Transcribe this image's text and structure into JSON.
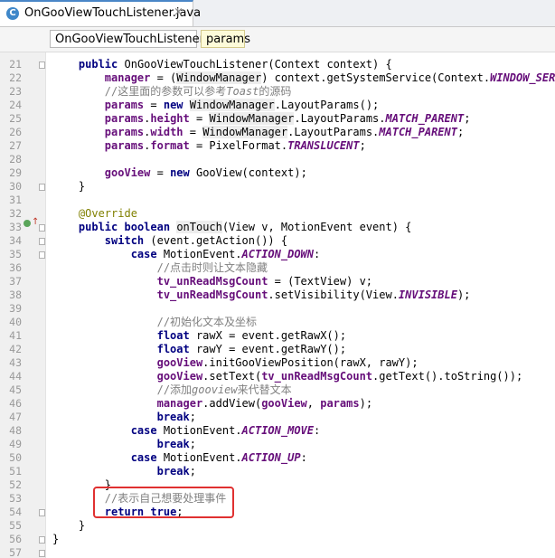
{
  "tab": {
    "icon": "class-c-icon",
    "title": "OnGooViewTouchListener.java",
    "close": "×"
  },
  "breadcrumbs": [
    "OnGooViewTouchListener",
    "params"
  ],
  "line_numbers": [
    "21",
    "22",
    "23",
    "24",
    "25",
    "26",
    "27",
    "28",
    "29",
    "30",
    "31",
    "32",
    "33",
    "34",
    "35",
    "36",
    "37",
    "38",
    "39",
    "40",
    "41",
    "42",
    "43",
    "44",
    "45",
    "46",
    "47",
    "48",
    "49",
    "50",
    "51",
    "52",
    "53",
    "54",
    "55",
    "56",
    "57"
  ],
  "code": {
    "l21": {
      "a": "public",
      "b": " OnGooViewTouchListener(Context context) {"
    },
    "l22": {
      "a": "manager",
      "b": " = (",
      "c": "WindowManager",
      "d": ") context.getSystemService(Context.",
      "e": "WINDOW_SERVIC"
    },
    "l23": {
      "a": "//这里面的参数可以参考",
      "b": "Toast",
      "c": "的源码"
    },
    "l24": {
      "a": "params",
      "b": " = ",
      "c": "new",
      "d": " ",
      "e": "WindowManager",
      "f": ".LayoutParams();"
    },
    "l25": {
      "a": "params",
      "b": ".",
      "c": "height",
      "d": " = ",
      "e": "WindowManager",
      "f": ".LayoutParams.",
      "g": "MATCH_PARENT",
      "h": ";"
    },
    "l26": {
      "a": "params",
      "b": ".",
      "c": "width",
      "d": " = ",
      "e": "WindowManager",
      "f": ".LayoutParams.",
      "g": "MATCH_PARENT",
      "h": ";"
    },
    "l27": {
      "a": "params",
      "b": ".",
      "c": "format",
      "d": " = PixelFormat.",
      "e": "TRANSLUCENT",
      "f": ";"
    },
    "l29": {
      "a": "gooView",
      "b": " = ",
      "c": "new",
      "d": " GooView(context);"
    },
    "l30": {
      "a": "}"
    },
    "l32": {
      "a": "@Override"
    },
    "l33": {
      "a": "public",
      "b": " ",
      "c": "boolean",
      "d": " ",
      "e": "onTouch",
      "f": "(View v, MotionEvent event) {"
    },
    "l34": {
      "a": "switch",
      "b": " (event.getAction()) {"
    },
    "l35": {
      "a": "case",
      "b": " MotionEvent.",
      "c": "ACTION_DOWN",
      "d": ":"
    },
    "l36": {
      "a": "//点击时则让文本隐藏"
    },
    "l37": {
      "a": "tv_unReadMsgCount",
      "b": " = (TextView) v;"
    },
    "l38": {
      "a": "tv_unReadMsgCount",
      "b": ".setVisibility(View.",
      "c": "INVISIBLE",
      "d": ");"
    },
    "l40": {
      "a": "//初始化文本及坐标"
    },
    "l41": {
      "a": "float",
      "b": " rawX = event.getRawX();"
    },
    "l42": {
      "a": "float",
      "b": " rawY = event.getRawY();"
    },
    "l43": {
      "a": "gooView",
      "b": ".initGooViewPosition(rawX, rawY);"
    },
    "l44": {
      "a": "gooView",
      "b": ".setText(",
      "c": "tv_unReadMsgCount",
      "d": ".getText().toString());"
    },
    "l45": {
      "a": "//添加",
      "b": "gooview",
      "c": "来代替文本"
    },
    "l46": {
      "a": "manager",
      "b": ".addView(",
      "c": "gooView",
      "d": ", ",
      "e": "params",
      "f": ");"
    },
    "l47": {
      "a": "break",
      "b": ";"
    },
    "l48": {
      "a": "case",
      "b": " MotionEvent.",
      "c": "ACTION_MOVE",
      "d": ":"
    },
    "l49": {
      "a": "break",
      "b": ";"
    },
    "l50": {
      "a": "case",
      "b": " MotionEvent.",
      "c": "ACTION_UP",
      "d": ":"
    },
    "l51": {
      "a": "break",
      "b": ";"
    },
    "l52": {
      "a": "}"
    },
    "l53": {
      "a": "//表示自己想要处理事件"
    },
    "l54": {
      "a": "return",
      "b": " ",
      "c": "true",
      "d": ";"
    },
    "l55": {
      "a": "}"
    },
    "l56": {
      "a": "}"
    }
  },
  "colors": {
    "keyword": "#000080",
    "field": "#660e7a",
    "comment": "#808080",
    "annotation": "#808000",
    "highlight_box": "#e03131"
  },
  "gutter_icons": [
    "override-method-icon",
    "implemented-up-arrow-icon"
  ]
}
